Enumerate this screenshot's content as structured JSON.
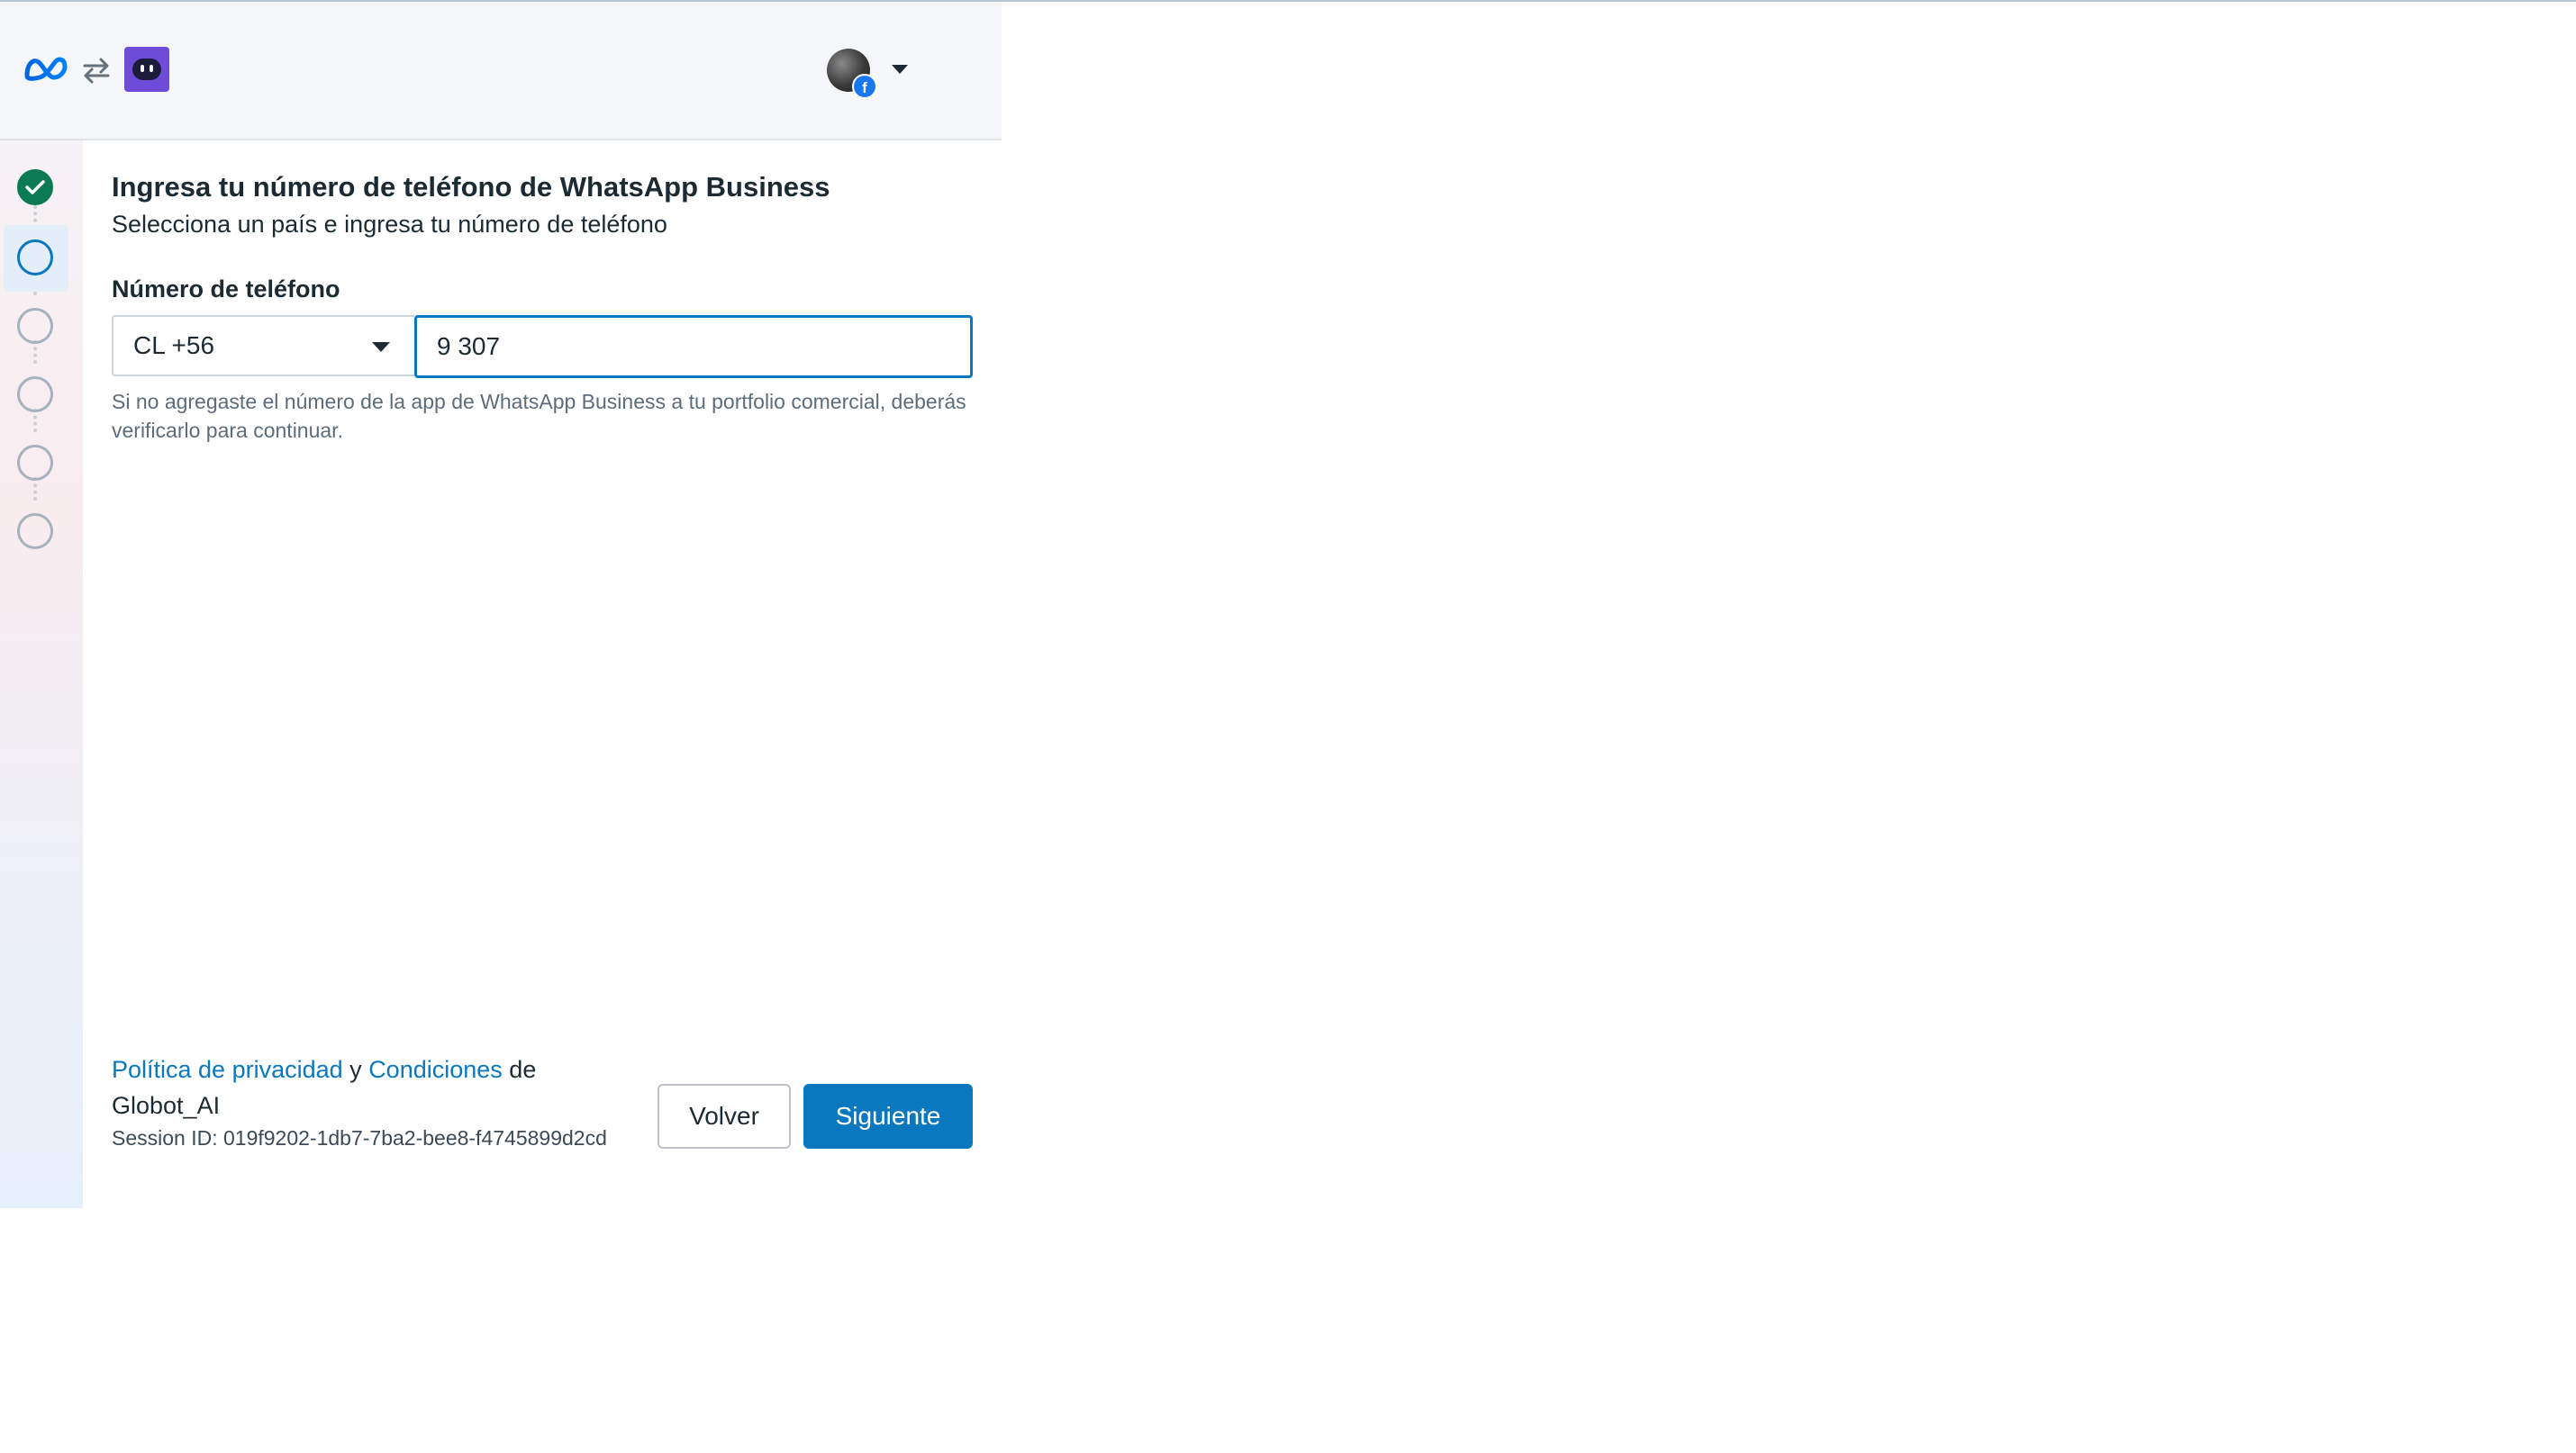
{
  "header": {
    "logos": [
      "meta-logo",
      "swap-icon",
      "app-logo"
    ],
    "account": {
      "avatar": "avatar",
      "badge": "facebook-icon",
      "menu_icon": "caret-down-icon"
    }
  },
  "stepper": {
    "steps": [
      {
        "state": "completed",
        "icon": "check-icon"
      },
      {
        "state": "current"
      },
      {
        "state": "pending"
      },
      {
        "state": "pending"
      },
      {
        "state": "pending"
      },
      {
        "state": "pending"
      }
    ],
    "colors": {
      "done": "#0a7b54",
      "current": "#0a78be",
      "pending": "#a8b2bc"
    }
  },
  "main": {
    "title": "Ingresa tu número de teléfono de WhatsApp Business",
    "subtitle": "Selecciona un país e ingresa tu número de teléfono",
    "phone_label": "Número de teléfono",
    "country_code": "CL +56",
    "phone_value": "9 307",
    "helper_text": "Si no agregaste el número de la app de WhatsApp Business a tu portfolio comercial, deberás verificarlo para continuar."
  },
  "footer": {
    "privacy_link": "Política de privacidad",
    "conjunction": "y",
    "terms_link": "Condiciones",
    "of_text": "de",
    "app_name": "Globot_AI",
    "session_id": "Session ID: 019f9202-1db7-7ba2-bee8-f4745899d2cd",
    "back_label": "Volver",
    "next_label": "Siguiente"
  },
  "colors": {
    "accent": "#0a78be",
    "success": "#0a7b54",
    "app_logo_bg": "#6e4bd8"
  }
}
